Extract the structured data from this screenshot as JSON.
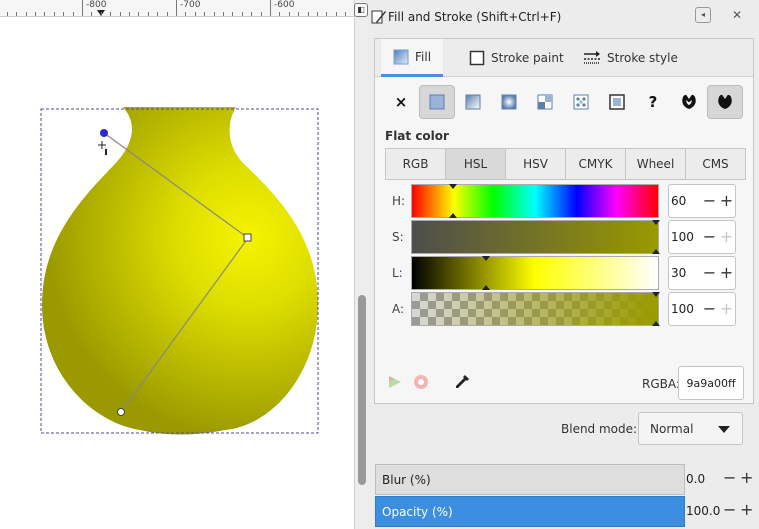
{
  "ruler": {
    "labels": [
      "-800",
      "-700",
      "-600"
    ]
  },
  "panel": {
    "title": "Fill and Stroke (Shift+Ctrl+F)",
    "tabs": [
      {
        "label": "Fill",
        "icon": "fill-swatch-icon",
        "active": true
      },
      {
        "label": "Stroke paint",
        "icon": "stroke-paint-icon",
        "active": false
      },
      {
        "label": "Stroke style",
        "icon": "stroke-style-icon",
        "active": false
      }
    ],
    "paint_types": [
      {
        "name": "no-paint",
        "glyph": "×"
      },
      {
        "name": "flat-color",
        "active": true
      },
      {
        "name": "linear-gradient"
      },
      {
        "name": "radial-gradient"
      },
      {
        "name": "mesh-gradient"
      },
      {
        "name": "pattern"
      },
      {
        "name": "swatch"
      },
      {
        "name": "unset",
        "glyph": "?"
      },
      {
        "name": "fill-rule-evenodd"
      },
      {
        "name": "fill-rule-nonzero",
        "active": true
      }
    ],
    "flat_color_label": "Flat color",
    "color_modes": [
      "RGB",
      "HSL",
      "HSV",
      "CMYK",
      "Wheel",
      "CMS"
    ],
    "active_mode": "HSL",
    "sliders": [
      {
        "label": "H:",
        "value": "60",
        "level": 0.167
      },
      {
        "label": "S:",
        "value": "100",
        "level": 1.0
      },
      {
        "label": "L:",
        "value": "30",
        "level": 0.3
      },
      {
        "label": "A:",
        "value": "100",
        "level": 1.0
      }
    ],
    "rgba_label": "RGBA:",
    "rgba_value": "9a9a00ff",
    "blend_label": "Blend mode:",
    "blend_value": "Normal",
    "blur_label": "Blur (%)",
    "blur_value": "0.0",
    "opacity_label": "Opacity (%)",
    "opacity_value": "100.0"
  },
  "colors": {
    "fill": "#9a9a00",
    "accent": "#3b8ee0",
    "gradient_start": "#f6f400",
    "gradient_end": "#9a9a00"
  }
}
